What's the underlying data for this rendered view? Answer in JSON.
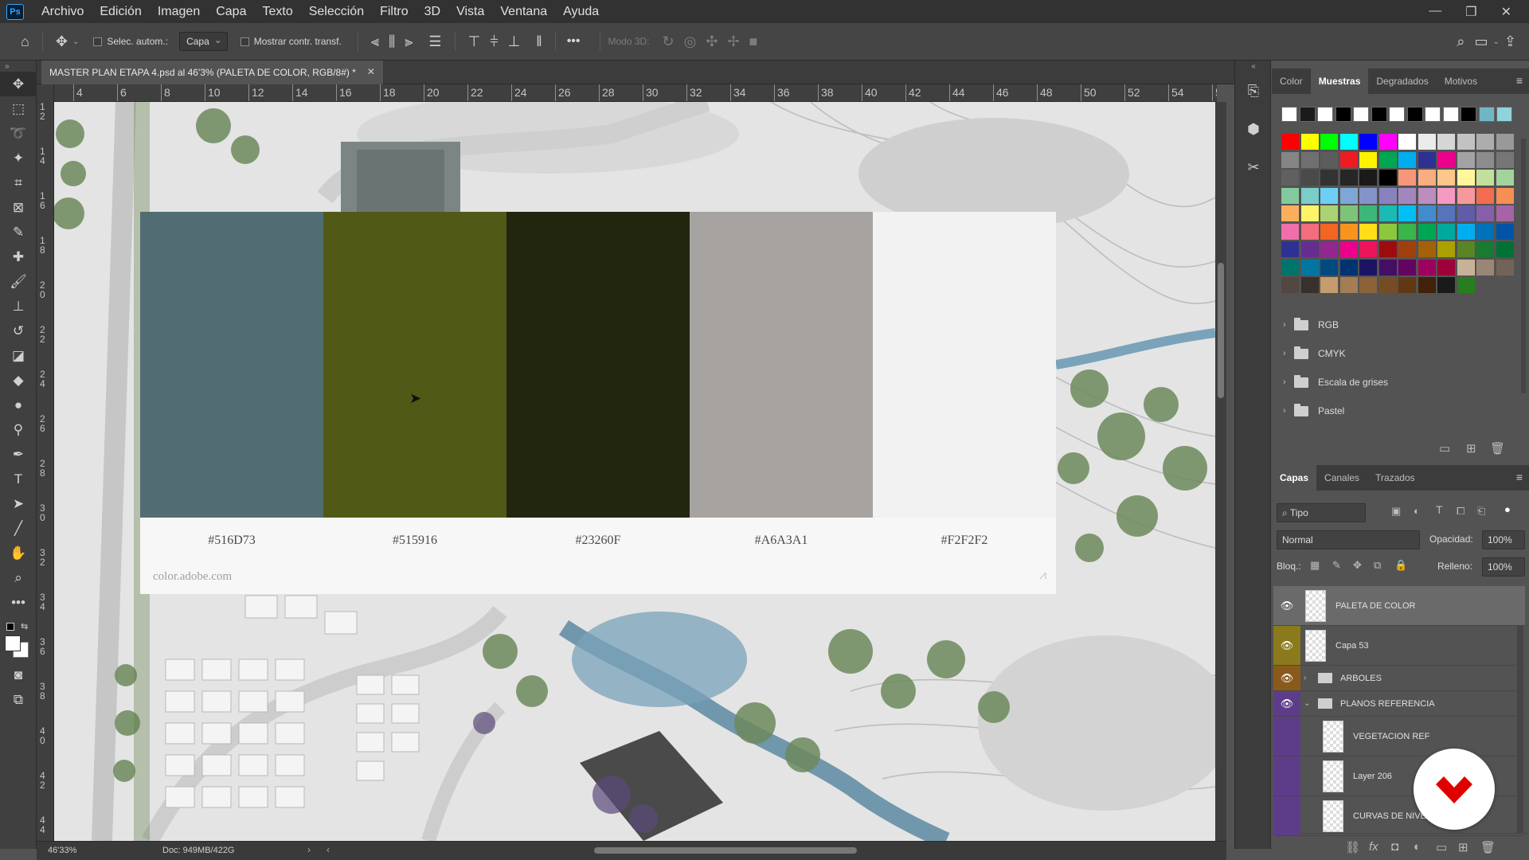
{
  "app": {
    "logo": "Ps",
    "menu": [
      "Archivo",
      "Edición",
      "Imagen",
      "Capa",
      "Texto",
      "Selección",
      "Filtro",
      "3D",
      "Vista",
      "Ventana",
      "Ayuda"
    ],
    "window_controls": [
      "—",
      "❐",
      "✕"
    ]
  },
  "options_bar": {
    "auto_select_label": "Selec. autom.:",
    "auto_select_value": "Capa",
    "show_transform_label": "Mostrar contr. transf.",
    "mode_3d_label": "Modo 3D:",
    "more_label": "•••"
  },
  "document": {
    "tab_title": "MASTER PLAN ETAPA 4.psd al 46'3% (PALETA DE COLOR, RGB/8#) *",
    "zoom": "46'33%",
    "doc_size": "Doc: 949MB/422G"
  },
  "rulers": {
    "top": [
      "4",
      "6",
      "8",
      "10",
      "12",
      "14",
      "16",
      "18",
      "20",
      "22",
      "24",
      "26",
      "28",
      "30",
      "32",
      "34",
      "36",
      "38",
      "40",
      "42",
      "44",
      "46",
      "48",
      "50",
      "52",
      "54",
      "5"
    ],
    "left": [
      "1\n2",
      "1\n4",
      "1\n6",
      "1\n8",
      "2\n0",
      "2\n2",
      "2\n4",
      "2\n6",
      "2\n8",
      "3\n0",
      "3\n2",
      "3\n4",
      "3\n6",
      "3\n8",
      "4\n0",
      "4\n2",
      "4\n4"
    ]
  },
  "palette": {
    "swatches": [
      {
        "color": "#516D73",
        "label": "#516D73"
      },
      {
        "color": "#515916",
        "label": "#515916"
      },
      {
        "color": "#23260F",
        "label": "#23260F"
      },
      {
        "color": "#A6A3A1",
        "label": "#A6A3A1"
      },
      {
        "color": "#F2F2F2",
        "label": "#F2F2F2"
      }
    ],
    "source": "color.adobe.com"
  },
  "swatches_panel": {
    "tabs": [
      "Color",
      "Muestras",
      "Degradados",
      "Motivos"
    ],
    "active_tab": "Muestras",
    "recent": [
      "#ffffff",
      "#1a1a1a",
      "#ffffff",
      "#000000",
      "#ffffff",
      "#000000",
      "#ffffff",
      "#000000",
      "#ffffff",
      "#ffffff",
      "#000000",
      "#6fb7c7",
      "#8fd3dc"
    ],
    "grid": [
      [
        "#ff0000",
        "#ffff00",
        "#00ff00",
        "#00ffff",
        "#0000ff",
        "#ff00ff",
        "#ffffff",
        "#ebebeb",
        "#d6d6d6",
        "#c2c2c2",
        "#adadad",
        "#999999"
      ],
      [
        "#858585",
        "#707070",
        "#5c5c5c",
        "#ed1c24",
        "#fff200",
        "#00a651",
        "#00aeef",
        "#2e3192",
        "#ec008c",
        "#a3a3a3",
        "#8c8c8c",
        "#767676"
      ],
      [
        "#606060",
        "#4a4a4a",
        "#333333",
        "#262626",
        "#1a1a1a",
        "#000000",
        "#f7977a",
        "#f9ad81",
        "#fdc68a",
        "#fff79a",
        "#c4df9b",
        "#a3d39c"
      ],
      [
        "#82ca9d",
        "#7bcdc8",
        "#6ecff6",
        "#7ea7d8",
        "#8493ca",
        "#8882be",
        "#a187be",
        "#bc8dbf",
        "#f49ac2",
        "#f6989d",
        "#f26c4f",
        "#f68e55"
      ],
      [
        "#fbaf5d",
        "#fff467",
        "#acd372",
        "#7cc576",
        "#3bb878",
        "#1abbb4",
        "#00bff3",
        "#438ccb",
        "#5574b9",
        "#605ca8",
        "#855fa8",
        "#a763a8"
      ],
      [
        "#f06eaa",
        "#f26d7d",
        "#f26522",
        "#f7941d",
        "#ffde17",
        "#8dc73f",
        "#39b54a",
        "#00a651",
        "#00a99d",
        "#00aeef",
        "#0072bc",
        "#0054a6"
      ],
      [
        "#2e3192",
        "#662d91",
        "#92278f",
        "#ec008c",
        "#ed145b",
        "#9e0b0f",
        "#a0410d",
        "#a36209",
        "#aba000",
        "#598527",
        "#197b30",
        "#007236"
      ],
      [
        "#00746b",
        "#0076a3",
        "#004a80",
        "#003471",
        "#1b1464",
        "#440e62",
        "#630460",
        "#9e005d",
        "#9e0039",
        "#c7b299",
        "#998675",
        "#736357"
      ],
      [
        "#534741",
        "#37302d",
        "#c69c6d",
        "#a67c52",
        "#8c6239",
        "#754c24",
        "#603913",
        "#42210b",
        "#1a1a1a",
        "#287d1e",
        "#535353",
        "#535353"
      ]
    ],
    "folders": [
      "RGB",
      "CMYK",
      "Escala de grises",
      "Pastel"
    ]
  },
  "layers_panel": {
    "tabs": [
      "Capas",
      "Canales",
      "Trazados"
    ],
    "active_tab": "Capas",
    "filter_label": "Tipo",
    "blend_mode": "Normal",
    "opacity_label": "Opacidad:",
    "opacity_value": "100%",
    "lock_label": "Bloq.:",
    "fill_label": "Relleno:",
    "fill_value": "100%",
    "layers": [
      {
        "name": "PALETA DE COLOR",
        "kind": "layer",
        "visible": true,
        "color": "none",
        "selected": true
      },
      {
        "name": "Capa 53",
        "kind": "layer",
        "visible": true,
        "color": "#8a7a1c",
        "selected": false
      },
      {
        "name": "ARBOLES",
        "kind": "group",
        "visible": true,
        "color": "#8a5a1c",
        "selected": false
      },
      {
        "name": "PLANOS REFERENCIA",
        "kind": "group-open",
        "visible": true,
        "color": "#5d3d8a",
        "selected": false
      },
      {
        "name": "VEGETACION REF",
        "kind": "child",
        "visible": false,
        "color": "#5d3d8a",
        "selected": false
      },
      {
        "name": "Layer 206",
        "kind": "child",
        "visible": false,
        "color": "#5d3d8a",
        "selected": false
      },
      {
        "name": "CURVAS DE NIVEL",
        "kind": "child",
        "visible": false,
        "color": "#5d3d8a",
        "selected": false
      }
    ]
  },
  "overlay_logo": "video-channel-logo"
}
